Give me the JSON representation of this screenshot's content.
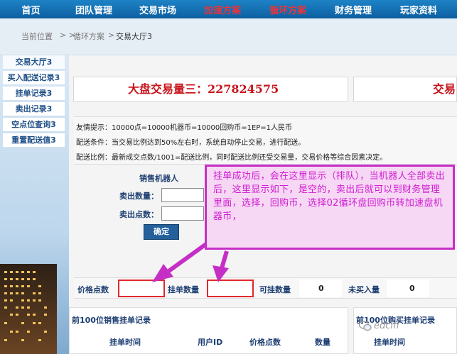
{
  "nav": {
    "items": [
      {
        "label": "首页",
        "hot": false
      },
      {
        "label": "团队管理",
        "hot": false
      },
      {
        "label": "交易市场",
        "hot": false
      },
      {
        "label": "加速方案",
        "hot": true
      },
      {
        "label": "循环方案",
        "hot": true
      },
      {
        "label": "财务管理",
        "hot": false
      },
      {
        "label": "玩家资料",
        "hot": false
      }
    ]
  },
  "breadcrumb": {
    "current_position": "当前位置",
    "sep": "> >",
    "section": "循环方案",
    "sep2": ">",
    "page": "交易大厅3"
  },
  "sidebar": {
    "items": [
      {
        "label": "交易大厅3"
      },
      {
        "label": "买入配送记录3"
      },
      {
        "label": "挂单记录3"
      },
      {
        "label": "卖出记录3"
      },
      {
        "label": "空点位查询3"
      },
      {
        "label": "重置配送值3"
      }
    ]
  },
  "banner": {
    "left": "大盘交易量三：227824575",
    "right": "交易"
  },
  "info": {
    "line1": "友情提示：10000点=10000机器币=10000回购币=1EP=1人民币",
    "line2": "配送条件：当交易比例达到50%左右时，系统自动停止交易，进行配送。",
    "line3": "配送比例：最新成交点数/1001=配送比例，同时配送比例还受交易量，交易价格等综合因素决定。"
  },
  "sell_form": {
    "title": "销售机器人",
    "qty_label": "卖出数量：",
    "points_label": "卖出点数：",
    "qty_value": "",
    "points_value": "",
    "confirm": "确定"
  },
  "stats": {
    "price_label": "价格点数",
    "price_value": "",
    "pending_label": "挂单数量",
    "pending_value": "",
    "available_label": "可挂数量",
    "available_value": "0",
    "unbought_label": "未买入量",
    "unbought_value": "0"
  },
  "sell_records": {
    "title": "前100位销售挂单记录",
    "columns": [
      "挂单时间",
      "用户ID",
      "价格点数",
      "数量"
    ]
  },
  "buy_records": {
    "title": "前100位购买挂单记录",
    "columns": [
      "挂单时间"
    ]
  },
  "annotation": {
    "text": "挂单成功后，会在这里显示（排队），当机器人全部卖出后，这里显示如下，是空的，卖出后就可以到财务管理里面，选择，回购币，选择02循环盘回购币转加速盘机器币，"
  },
  "watermark": {
    "text": "edcifi"
  },
  "colors": {
    "nav_bg": "#1577bb",
    "hot_text": "#e8343c",
    "banner_text": "#c8161d",
    "annotation": "#c62fc6",
    "highlight_box": "#e0292e"
  }
}
